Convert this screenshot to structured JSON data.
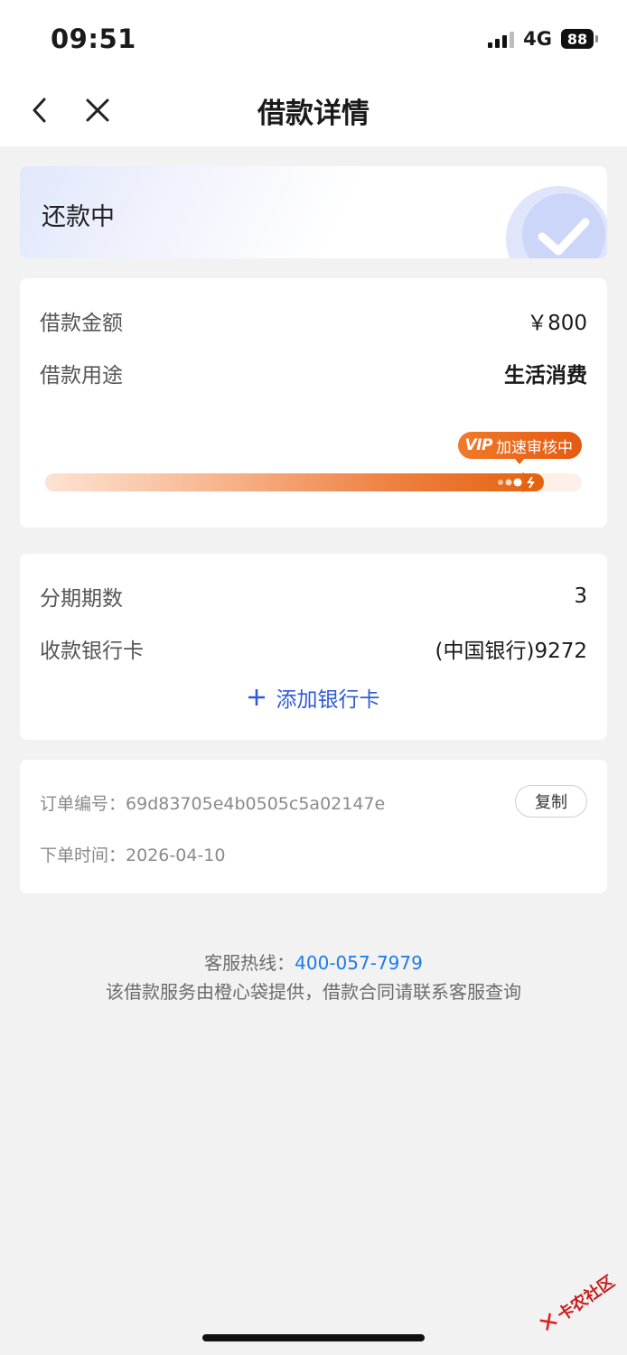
{
  "status_bar": {
    "time": "09:51",
    "network": "4G",
    "battery": "88"
  },
  "nav": {
    "title": "借款详情",
    "back_icon": "chevron-left-icon",
    "close_icon": "close-icon"
  },
  "loan_status": {
    "label": "还款中",
    "icon": "check-circle-icon",
    "accent": "#dfe5fb"
  },
  "loan_info": {
    "amount_label": "借款金额",
    "amount_value": "￥800",
    "purpose_label": "借款用途",
    "purpose_value": "生活消费",
    "badge_vip": "VIP",
    "badge_text": "加速审核中",
    "progress_fraction": 0.93,
    "progress_color": "#e5620f"
  },
  "installment": {
    "periods_label": "分期期数",
    "periods_value": "3",
    "bank_label": "收款银行卡",
    "bank_value": "(中国银行)9272",
    "add_card_label": "添加银行卡",
    "add_icon": "plus-icon",
    "accent": "#2f5bd6"
  },
  "order": {
    "number_label": "订单编号：",
    "number_value": "69d83705e4b0505c5a02147e",
    "copy_label": "复制",
    "time_label": "下单时间：",
    "time_value": "2026-04-10"
  },
  "footer": {
    "hotline_label": "客服热线：",
    "hotline_number": "400-057-7979",
    "hotline_color": "#1e7be8",
    "notice": "该借款服务由橙心袋提供，借款合同请联系客服查询"
  },
  "watermark": {
    "text": "卡农社区"
  }
}
